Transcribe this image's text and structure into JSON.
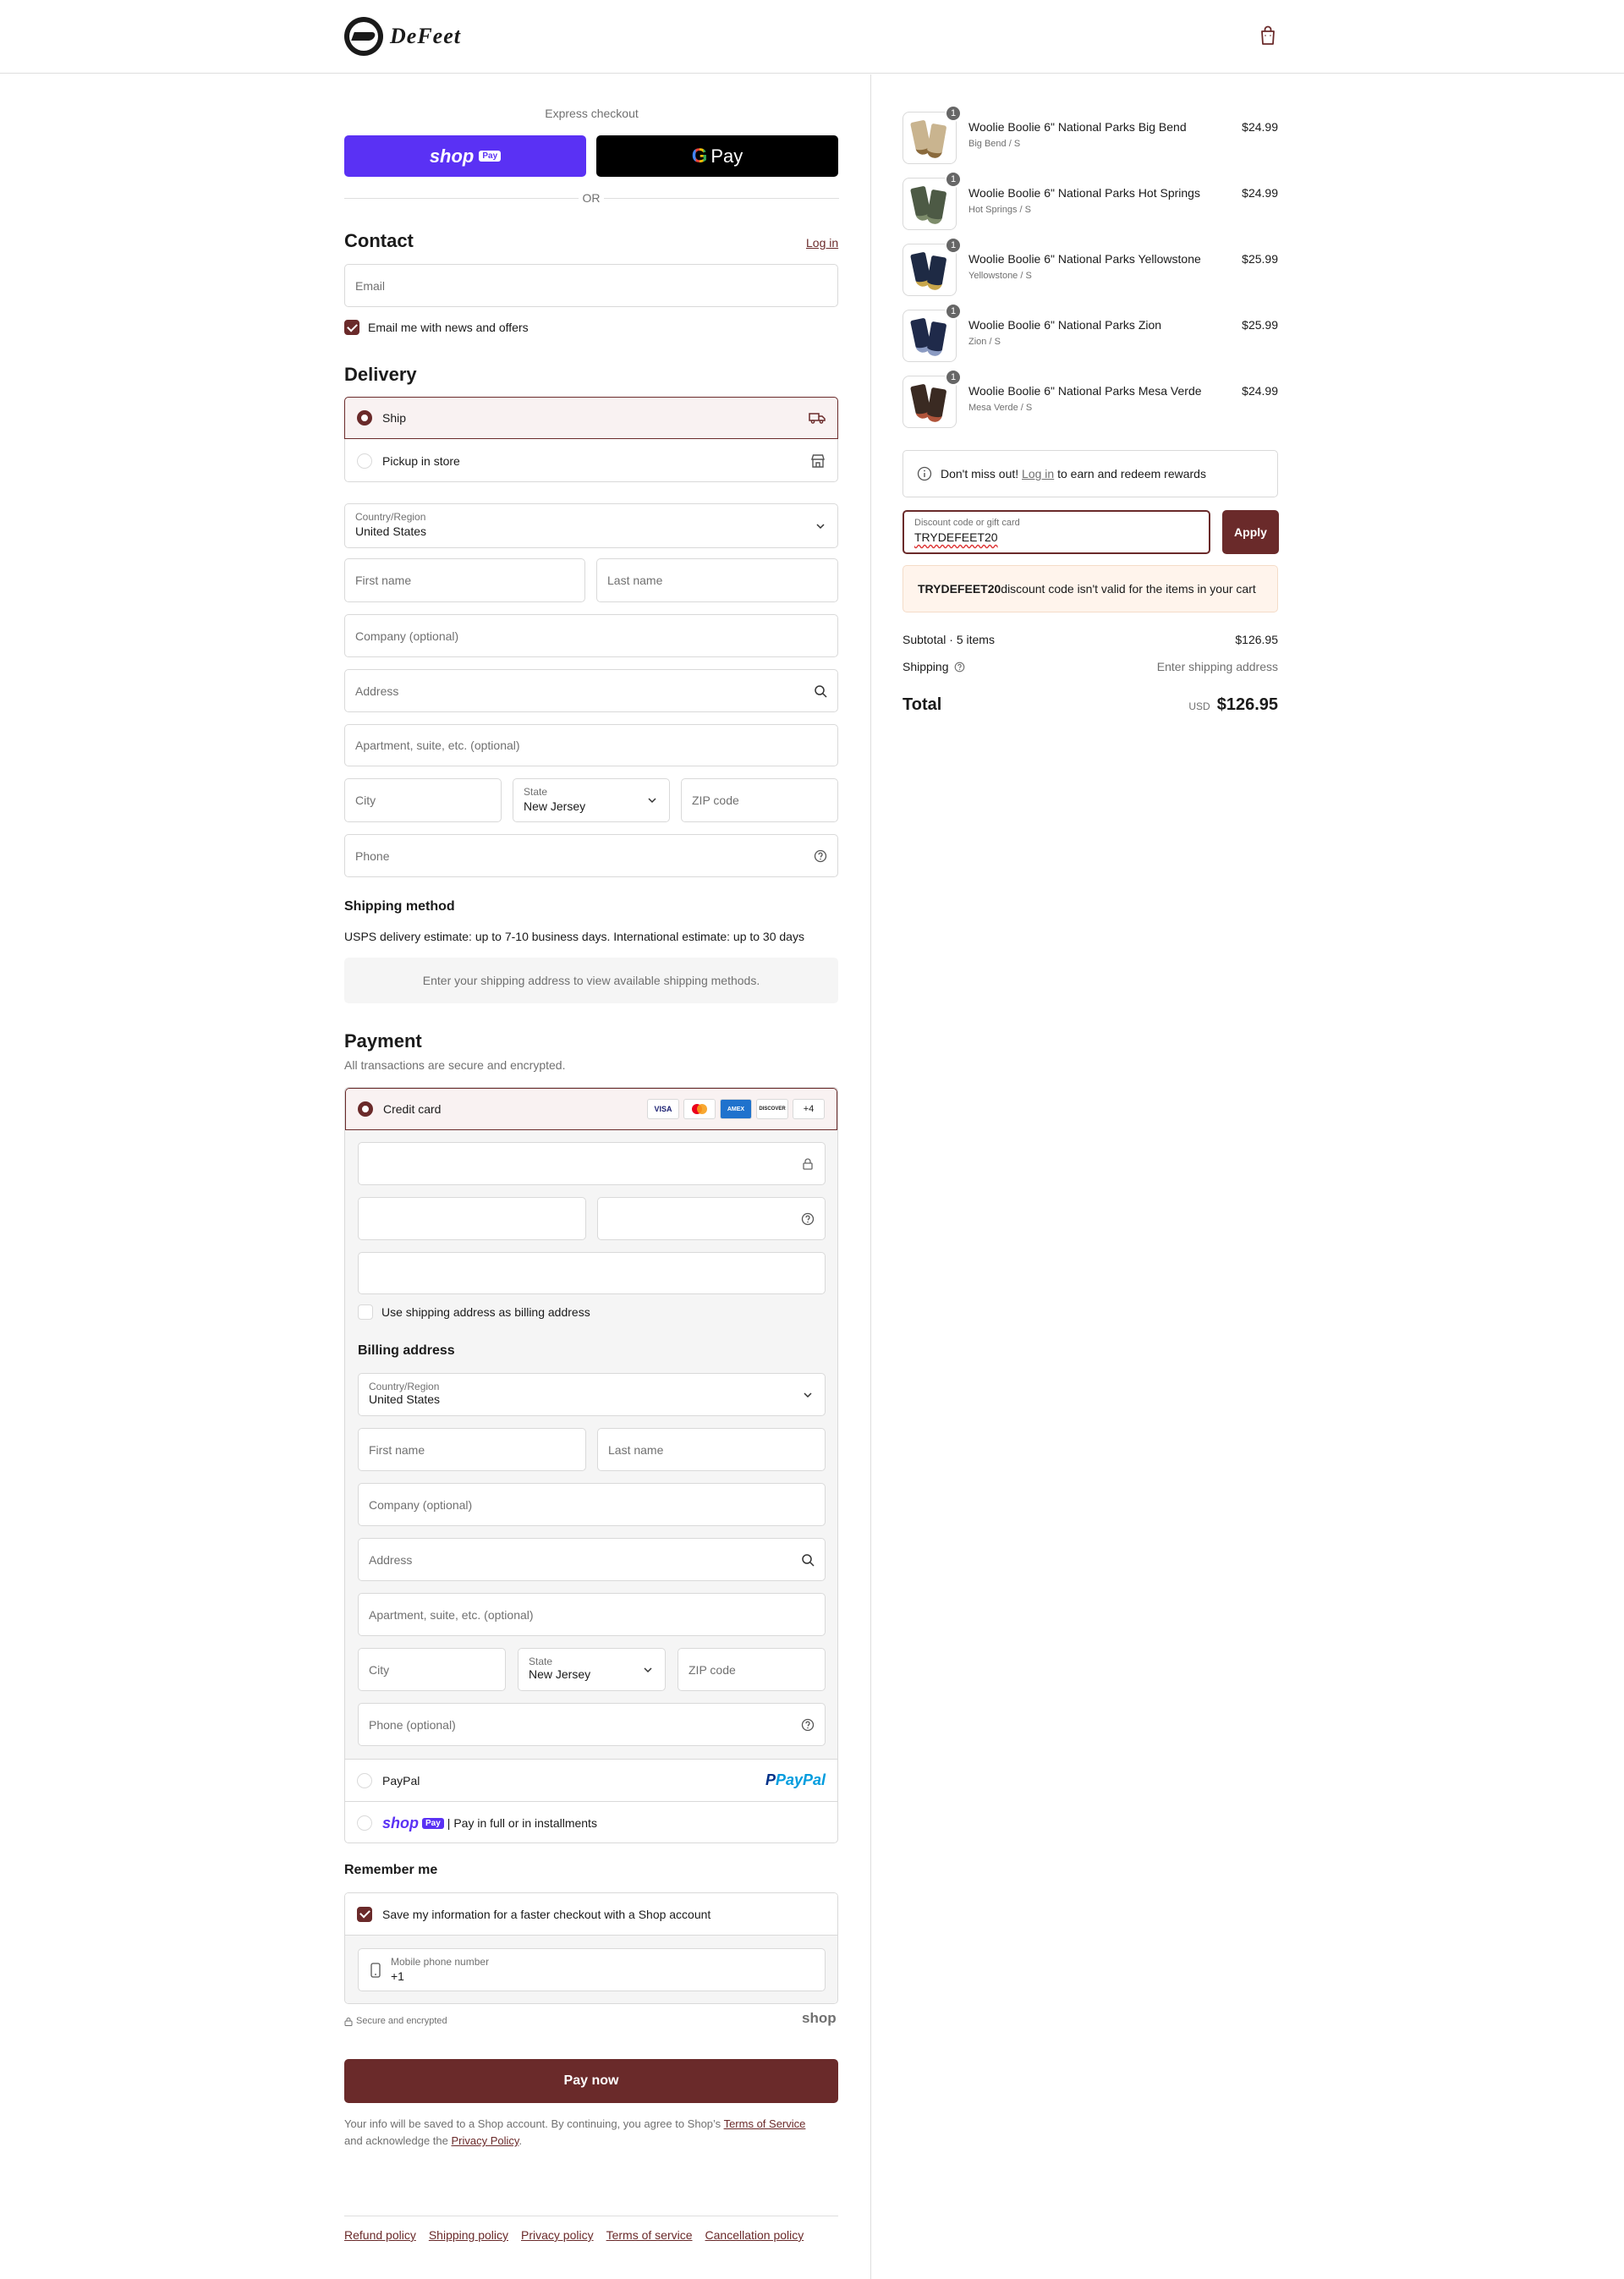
{
  "header": {
    "brand": "DeFeet"
  },
  "express": {
    "title": "Express checkout",
    "shop_pay": "shop",
    "shop_pay_badge": "Pay",
    "gpay": "Pay",
    "or": "OR"
  },
  "contact": {
    "title": "Contact",
    "login": "Log in",
    "email_placeholder": "Email",
    "news_label": "Email me with news and offers"
  },
  "delivery": {
    "title": "Delivery",
    "ship": "Ship",
    "pickup": "Pickup in store",
    "country_label": "Country/Region",
    "country": "United States",
    "first_name": "First name",
    "last_name": "Last name",
    "company": "Company (optional)",
    "address": "Address",
    "apartment": "Apartment, suite, etc. (optional)",
    "city": "City",
    "state_label": "State",
    "state": "New Jersey",
    "zip": "ZIP code",
    "phone": "Phone"
  },
  "shipping_method": {
    "title": "Shipping method",
    "estimate": "USPS delivery estimate: up to 7-10 business days. International estimate: up to 30 days",
    "notice": "Enter your shipping address to view available shipping methods."
  },
  "payment": {
    "title": "Payment",
    "subtitle": "All transactions are secure and encrypted.",
    "credit_card": "Credit card",
    "badges": [
      "VISA",
      "MC",
      "AMEX",
      "DISCOVER",
      "+4"
    ],
    "use_shipping": "Use shipping address as billing address",
    "billing_title": "Billing address",
    "billing_country_label": "Country/Region",
    "billing_country": "United States",
    "billing_first": "First name",
    "billing_last": "Last name",
    "billing_company": "Company (optional)",
    "billing_address": "Address",
    "billing_apartment": "Apartment, suite, etc. (optional)",
    "billing_city": "City",
    "billing_state_label": "State",
    "billing_state": "New Jersey",
    "billing_zip": "ZIP code",
    "billing_phone": "Phone (optional)",
    "paypal": "PayPal",
    "paypal_logo": "PayPal",
    "shoppay": "shop",
    "shoppay_badge": "Pay",
    "shoppay_text": "| Pay in full or in installments"
  },
  "remember": {
    "title": "Remember me",
    "save_label": "Save my information for a faster checkout with a Shop account",
    "phone_label": "Mobile phone number",
    "phone_value": "+1",
    "secure": "Secure and encrypted",
    "shop_logo": "shop"
  },
  "pay_now": "Pay now",
  "legal": {
    "text1": "Your info will be saved to a Shop account. By continuing, you agree to Shop’s ",
    "tos": "Terms of Service",
    "text2": "and acknowledge the ",
    "privacy": "Privacy Policy",
    "text3": "."
  },
  "footer": [
    "Refund policy",
    "Shipping policy",
    "Privacy policy",
    "Terms of service",
    "Cancellation policy"
  ],
  "order": {
    "items": [
      {
        "name": "Woolie Boolie 6\" National Parks Big Bend",
        "variant": "Big Bend / S",
        "price": "$24.99",
        "qty": "1",
        "color": "#c9b48f",
        "accent": "#8a6a3c"
      },
      {
        "name": "Woolie Boolie 6\" National Parks Hot Springs",
        "variant": "Hot Springs / S",
        "price": "$24.99",
        "qty": "1",
        "color": "#4d5a45",
        "accent": "#7d8c6b"
      },
      {
        "name": "Woolie Boolie 6\" National Parks Yellowstone",
        "variant": "Yellowstone / S",
        "price": "$25.99",
        "qty": "1",
        "color": "#1e2a44",
        "accent": "#c8a64a"
      },
      {
        "name": "Woolie Boolie 6\" National Parks Zion",
        "variant": "Zion / S",
        "price": "$25.99",
        "qty": "1",
        "color": "#1f2a4a",
        "accent": "#8a9ac2"
      },
      {
        "name": "Woolie Boolie 6\" National Parks Mesa Verde",
        "variant": "Mesa Verde / S",
        "price": "$24.99",
        "qty": "1",
        "color": "#3a2a22",
        "accent": "#b0543a"
      }
    ],
    "rewards": {
      "prefix": "Don't miss out! ",
      "login": "Log in",
      "suffix": " to earn and redeem rewards"
    },
    "discount_label": "Discount code or gift card",
    "discount_value": "TRYDEFEET20",
    "apply": "Apply",
    "error_code": "TRYDEFEET20",
    "error_text": " discount code isn't valid for the items in your cart",
    "subtotal_label": "Subtotal · 5 items",
    "subtotal": "$126.95",
    "shipping_label": "Shipping",
    "shipping_value": "Enter shipping address",
    "total_label": "Total",
    "currency": "USD",
    "total": "$126.95"
  },
  "colors": {
    "accent": "#6a2a2a",
    "shop": "#5a31f4",
    "error_bg": "#fff4ec"
  }
}
